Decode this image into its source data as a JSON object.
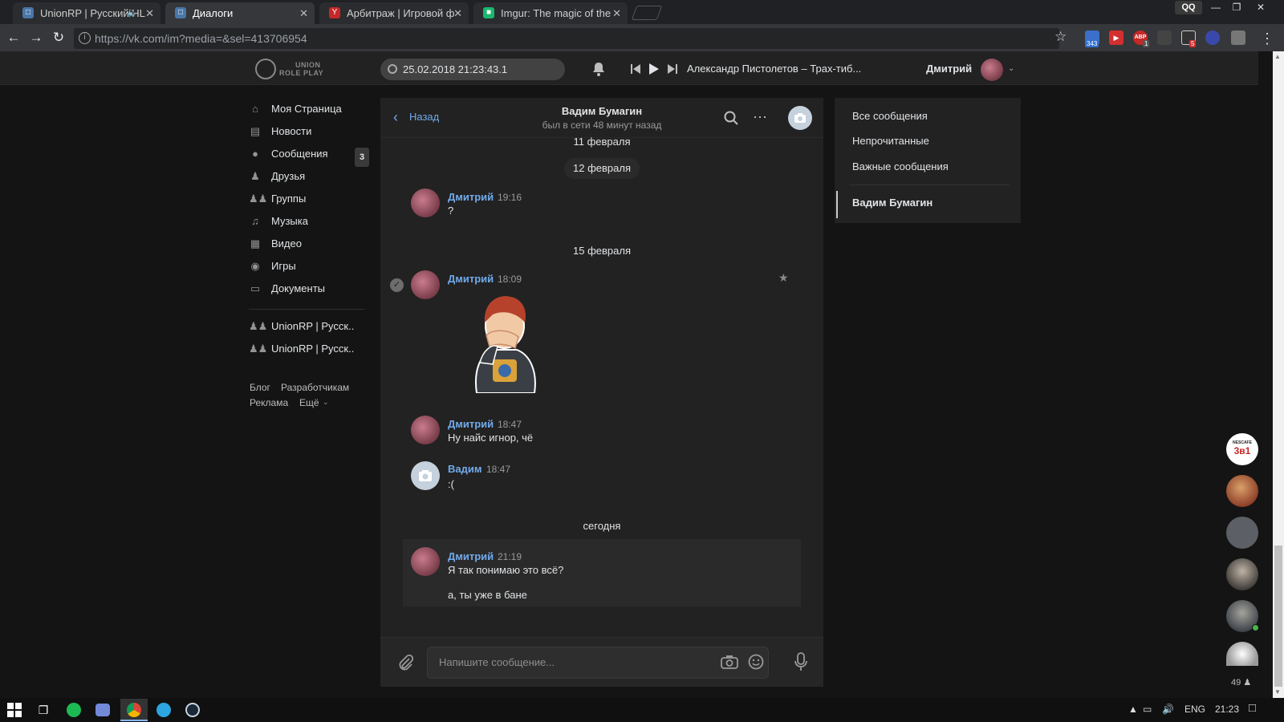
{
  "browser": {
    "tabs": [
      {
        "title": "UnionRP | Русский HL",
        "active": false
      },
      {
        "title": "Диалоги",
        "active": true
      },
      {
        "title": "Арбитраж | Игровой ф",
        "active": false
      },
      {
        "title": "Imgur: The magic of the",
        "active": false
      }
    ],
    "profile_label": "QQ",
    "url": "https://vk.com/im?media=&sel=413706954",
    "extension_badges": {
      "ext1": "343",
      "abp": "ABP",
      "abp_count": "1",
      "ext5": "5"
    }
  },
  "header": {
    "logo_line1": "UNION",
    "logo_line2": "ROLE PLAY",
    "search_value": "25.02.2018 21:23:43.1",
    "track": "Александр Пистолетов – Трах-тиб...",
    "user_name": "Дмитрий"
  },
  "left_menu": {
    "items": [
      {
        "label": "Моя Страница",
        "icon": "home-icon"
      },
      {
        "label": "Новости",
        "icon": "news-icon"
      },
      {
        "label": "Сообщения",
        "icon": "messages-icon"
      },
      {
        "label": "Друзья",
        "icon": "friends-icon"
      },
      {
        "label": "Группы",
        "icon": "groups-icon"
      },
      {
        "label": "Музыка",
        "icon": "music-icon"
      },
      {
        "label": "Видео",
        "icon": "video-icon"
      },
      {
        "label": "Игры",
        "icon": "games-icon"
      },
      {
        "label": "Документы",
        "icon": "documents-icon"
      }
    ],
    "messages_count": "3",
    "groups": [
      "UnionRP | Русск..",
      "UnionRP | Русск.."
    ],
    "footer": {
      "blog": "Блог",
      "developers": "Разработчикам",
      "ads": "Реклама",
      "more": "Ещё"
    }
  },
  "chat": {
    "back_label": "Назад",
    "peer_name": "Вадим Бумагин",
    "peer_status": "был в сети 48 минут назад",
    "dates": {
      "d1": "11 февраля",
      "d2": "12 февраля",
      "d3": "15 февраля",
      "d4": "сегодня"
    },
    "messages": [
      {
        "author": "Дмитрий",
        "time": "19:16",
        "text": "?"
      },
      {
        "author": "Дмитрий",
        "time": "18:09",
        "text": ""
      },
      {
        "author": "Дмитрий",
        "time": "18:47",
        "text": "Ну найс игнор, чё"
      },
      {
        "author": "Вадим",
        "time": "18:47",
        "text": ":("
      },
      {
        "author": "Дмитрий",
        "time": "21:19",
        "text": "Я так понимаю это всё?",
        "text2": "а, ты уже в бане"
      }
    ],
    "input_placeholder": "Напишите сообщение..."
  },
  "filters": {
    "all": "Все сообщения",
    "unread": "Непрочитанные",
    "important": "Важные сообщения",
    "selected_dialog": "Вадим Бумагин"
  },
  "side": {
    "top_badge_line1": "NESCAFE",
    "top_badge_line2": "3в1",
    "online_count": "49"
  },
  "taskbar": {
    "language": "ENG",
    "clock": "21:23"
  },
  "colors": {
    "accent": "#71aaeb",
    "background": "#141414",
    "panel": "#222222"
  }
}
